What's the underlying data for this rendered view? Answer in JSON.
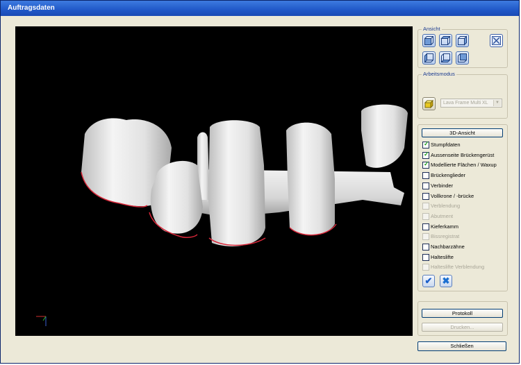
{
  "window": {
    "title": "Auftragsdaten"
  },
  "view_panel": {
    "title": "Ansicht",
    "buttons": [
      "view-front-icon",
      "view-top-icon",
      "view-right-icon",
      "view-left-icon",
      "view-bottom-icon",
      "view-back-icon"
    ],
    "fit_icon": "fit-to-window-icon"
  },
  "work_mode": {
    "title": "Arbeitsmodus",
    "material_icon": "material-block-icon",
    "selected": "Lava Frame Multi XL"
  },
  "layers": {
    "view3d_button": "3D-Ansicht",
    "items": [
      {
        "label": "Stumpfdaten",
        "checked": true,
        "enabled": true
      },
      {
        "label": "Aussenseite Brückengerüst",
        "checked": true,
        "enabled": true
      },
      {
        "label": "Modellierte Flächen / Waxup",
        "checked": true,
        "enabled": true
      },
      {
        "label": "Brückenglieder",
        "checked": false,
        "enabled": true
      },
      {
        "label": "Verbinder",
        "checked": false,
        "enabled": true
      },
      {
        "label": "Vollkrone / -brücke",
        "checked": false,
        "enabled": true
      },
      {
        "label": "Verblendung",
        "checked": false,
        "enabled": false
      },
      {
        "label": "Abutment",
        "checked": false,
        "enabled": false
      },
      {
        "label": "Kieferkamm",
        "checked": false,
        "enabled": true
      },
      {
        "label": "Bissregistrat",
        "checked": false,
        "enabled": false
      },
      {
        "label": "Nachbarzähne",
        "checked": false,
        "enabled": true
      },
      {
        "label": "Halteslifte",
        "checked": false,
        "enabled": true
      },
      {
        "label": "Halteslifte Verblendung",
        "checked": false,
        "enabled": false
      }
    ],
    "ok_icon": "checkmark-icon",
    "cancel_icon": "cancel-x-icon"
  },
  "actions": {
    "protocol": "Protokoll",
    "print": "Drucken..."
  },
  "close_label": "Schließen",
  "colors": {
    "title_bar": "#2058c8",
    "viewport_bg": "#000000",
    "margin_line": "#d8283a",
    "checkmark": "#21a121"
  }
}
